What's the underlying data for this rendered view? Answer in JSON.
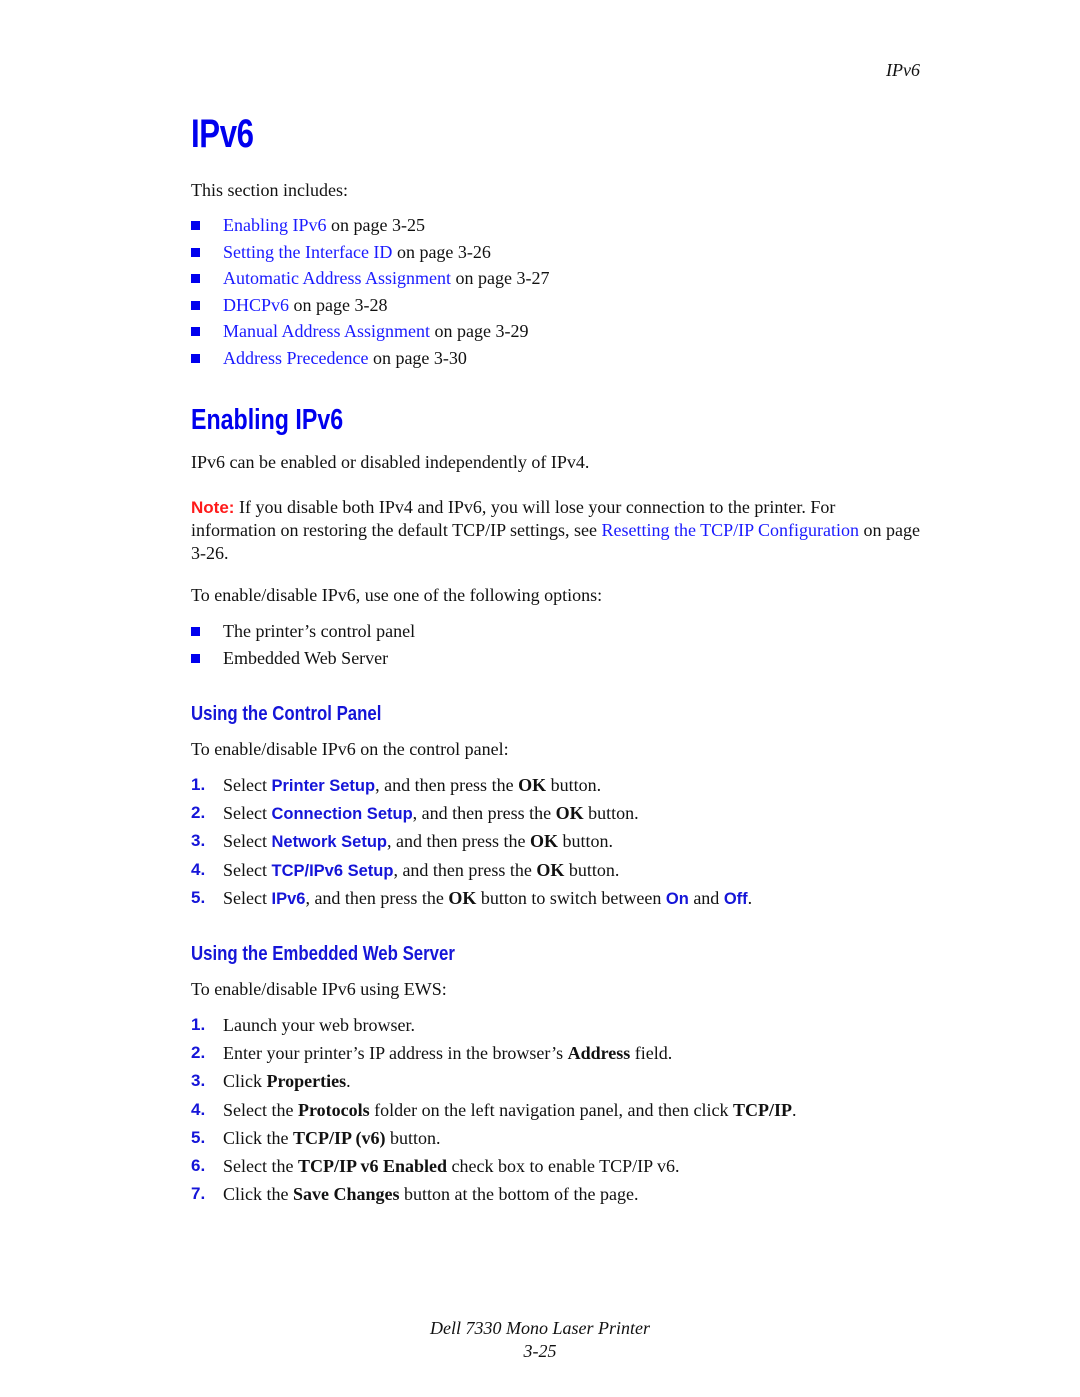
{
  "header": {
    "running_title": "IPv6"
  },
  "title": "IPv6",
  "intro": "This section includes:",
  "toc": [
    {
      "link": "Enabling IPv6",
      "suffix": " on page 3-25"
    },
    {
      "link": "Setting the Interface ID",
      "suffix": " on page 3-26"
    },
    {
      "link": "Automatic Address Assignment",
      "suffix": " on page 3-27"
    },
    {
      "link": "DHCPv6",
      "suffix": " on page 3-28"
    },
    {
      "link": "Manual Address Assignment",
      "suffix": " on page 3-29"
    },
    {
      "link": "Address Precedence",
      "suffix": " on page 3-30"
    }
  ],
  "enabling": {
    "heading": "Enabling IPv6",
    "body": "IPv6 can be enabled or disabled independently of IPv4.",
    "note": {
      "label": "Note:",
      "text1": " If you disable both IPv4 and IPv6, you will lose your connection to the printer. For information on restoring the default TCP/IP settings, see ",
      "link": "Resetting the TCP/IP Configuration",
      "text2": " on page 3-26."
    },
    "options_intro": "To enable/disable IPv6, use one of the following options:",
    "options": [
      "The printer’s control panel",
      "Embedded Web Server"
    ]
  },
  "control_panel": {
    "heading": "Using the Control Panel",
    "intro": "To enable/disable IPv6 on the control panel:",
    "steps": [
      {
        "num": "1.",
        "pre": "Select ",
        "ui": "Printer Setup",
        "mid": ", and then press the ",
        "bold": "OK",
        "post": " button."
      },
      {
        "num": "2.",
        "pre": "Select ",
        "ui": "Connection Setup",
        "mid": ", and then press the ",
        "bold": "OK",
        "post": " button."
      },
      {
        "num": "3.",
        "pre": "Select ",
        "ui": "Network Setup",
        "mid": ", and then press the ",
        "bold": "OK",
        "post": " button."
      },
      {
        "num": "4.",
        "pre": "Select ",
        "ui": "TCP/IPv6 Setup",
        "mid": ", and then press the ",
        "bold": "OK",
        "post": " button."
      },
      {
        "num": "5.",
        "pre": "Select ",
        "ui": "IPv6",
        "mid": ", and then press the ",
        "bold": "OK",
        "post": " button to switch between ",
        "ui2": "On",
        "and": " and ",
        "ui3": "Off",
        "end": "."
      }
    ]
  },
  "ews": {
    "heading": "Using the Embedded Web Server",
    "intro": "To enable/disable IPv6 using EWS:",
    "steps": [
      {
        "num": "1.",
        "pre": "Launch your web browser."
      },
      {
        "num": "2.",
        "pre": "Enter your printer’s IP address in the browser’s ",
        "bold": "Address",
        "post": " field."
      },
      {
        "num": "3.",
        "pre": "Click ",
        "bold": "Properties",
        "post": "."
      },
      {
        "num": "4.",
        "pre": "Select the ",
        "bold": "Protocols",
        "post": " folder on the left navigation panel, and then click ",
        "bold2": "TCP/IP",
        "end": "."
      },
      {
        "num": "5.",
        "pre": "Click the ",
        "bold": "TCP/IP (v6)",
        "post": " button."
      },
      {
        "num": "6.",
        "pre": "Select the ",
        "bold": "TCP/IP v6 Enabled",
        "post": " check box to enable TCP/IP v6."
      },
      {
        "num": "7.",
        "pre": "Click the ",
        "bold": "Save Changes",
        "post": " button at the bottom of the page."
      }
    ]
  },
  "footer": {
    "product": "Dell 7330 Mono Laser Printer",
    "page": "3-25"
  },
  "colors": {
    "heading_blue": "#0000ee",
    "link_blue": "#1a1aff",
    "note_red": "#ff1a1a"
  }
}
